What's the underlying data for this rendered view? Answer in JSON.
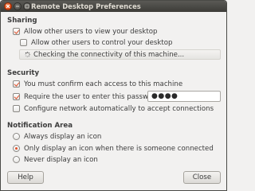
{
  "window": {
    "title": "Remote Desktop Preferences"
  },
  "sharing": {
    "heading": "Sharing",
    "allow_view": {
      "label": "Allow other users to view your desktop",
      "checked": true
    },
    "allow_control": {
      "label": "Allow other users to control your desktop",
      "checked": false
    },
    "status": {
      "text": "Checking the connectivity of this machine...",
      "icon": "spinner-icon"
    }
  },
  "security": {
    "heading": "Security",
    "confirm_access": {
      "label": "You must confirm each access to this machine",
      "checked": true
    },
    "require_password": {
      "label": "Require the user to enter this password:",
      "checked": true
    },
    "password_value": "●●●●",
    "configure_network": {
      "label": "Configure network automatically to accept connections",
      "checked": false
    }
  },
  "notification": {
    "heading": "Notification Area",
    "options": [
      {
        "label": "Always display an icon",
        "selected": false
      },
      {
        "label": "Only display an icon when there is someone connected",
        "selected": true
      },
      {
        "label": "Never display an icon",
        "selected": false
      }
    ]
  },
  "buttons": {
    "help": "Help",
    "close": "Close"
  },
  "colors": {
    "accent": "#e0502a",
    "titlebar": "#3d3c38",
    "background": "#f2f1f0"
  }
}
